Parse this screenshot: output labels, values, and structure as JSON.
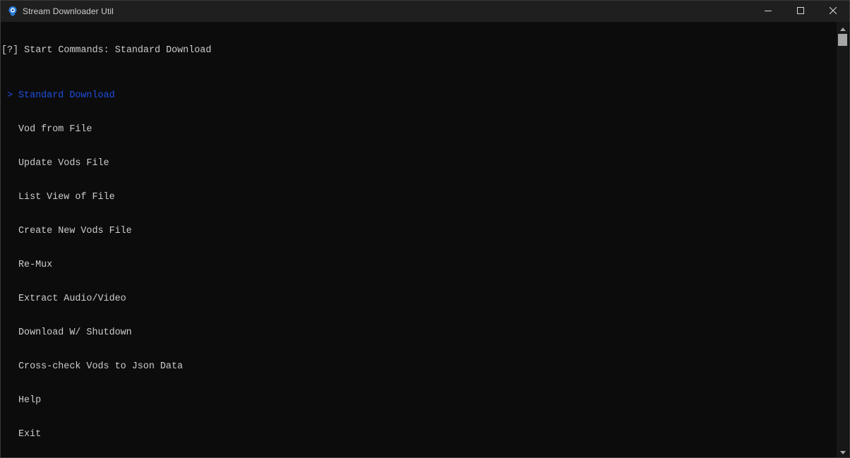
{
  "window": {
    "title": "Stream Downloader Util",
    "controls": {
      "minimize_icon": "minimize-icon",
      "maximize_icon": "maximize-icon",
      "close_icon": "close-icon"
    }
  },
  "console": {
    "prompt": {
      "open_bracket": "[",
      "mark": "?",
      "close_bracket": "]",
      "text": " Start Commands: Standard Download"
    },
    "pointer": ">",
    "menu": [
      {
        "label": "Standard Download",
        "selected": true
      },
      {
        "label": "Vod from File",
        "selected": false
      },
      {
        "label": "Update Vods File",
        "selected": false
      },
      {
        "label": "List View of File",
        "selected": false
      },
      {
        "label": "Create New Vods File",
        "selected": false
      },
      {
        "label": "Re-Mux",
        "selected": false
      },
      {
        "label": "Extract Audio/Video",
        "selected": false
      },
      {
        "label": "Download W/ Shutdown",
        "selected": false
      },
      {
        "label": "Cross-check Vods to Json Data",
        "selected": false
      },
      {
        "label": "Help",
        "selected": false
      },
      {
        "label": "Exit",
        "selected": false
      }
    ]
  },
  "colors": {
    "background": "#0c0c0c",
    "text": "#cccccc",
    "selected": "#1f4ee0",
    "titlebar": "#1f1f1f"
  }
}
